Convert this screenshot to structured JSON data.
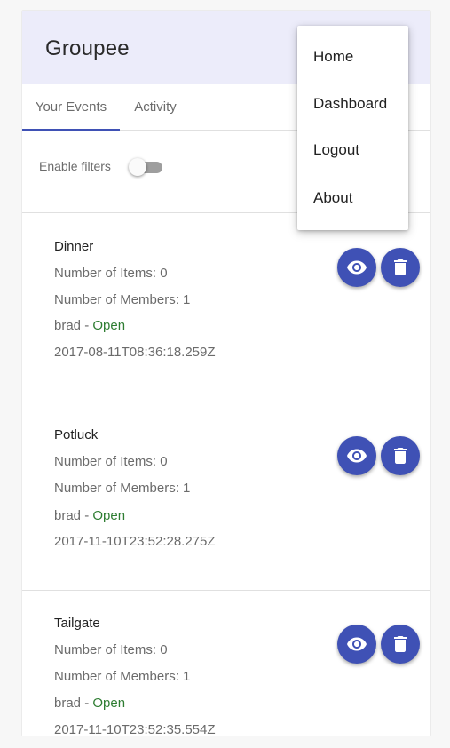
{
  "app": {
    "title": "Groupee"
  },
  "tabs": [
    {
      "label": "Your Events"
    },
    {
      "label": "Activity"
    }
  ],
  "filters": {
    "label": "Enable filters",
    "enabled": false
  },
  "events": [
    {
      "name": "Dinner",
      "items_text": "Number of Items: 0",
      "members_text": "Number of Members: 1",
      "owner": "brad",
      "separator": " - ",
      "status": "Open",
      "date": "2017-08-11T08:36:18.259Z"
    },
    {
      "name": "Potluck",
      "items_text": "Number of Items: 0",
      "members_text": "Number of Members: 1",
      "owner": "brad",
      "separator": " - ",
      "status": "Open",
      "date": "2017-11-10T23:52:28.275Z"
    },
    {
      "name": "Tailgate",
      "items_text": "Number of Items: 0",
      "members_text": "Number of Members: 1",
      "owner": "brad",
      "separator": " - ",
      "status": "Open",
      "date": "2017-11-10T23:52:35.554Z"
    }
  ],
  "menu": {
    "items": [
      {
        "label": "Home"
      },
      {
        "label": "Dashboard"
      },
      {
        "label": "Logout"
      },
      {
        "label": "About"
      }
    ]
  },
  "icons": {
    "view": "eye-icon",
    "delete": "trash-icon"
  },
  "colors": {
    "primary": "#3f51b5",
    "appbar": "#ececfa",
    "status_open": "#2e7d32"
  }
}
